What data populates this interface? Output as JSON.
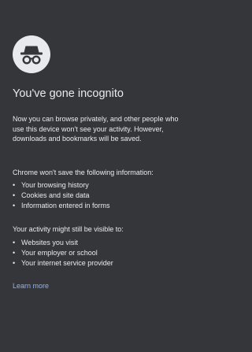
{
  "logo": {
    "icon": "incognito-icon",
    "background_color": "#e8eaed",
    "figure_color": "#35363a"
  },
  "title": "You've gone incognito",
  "intro": "Now you can browse privately, and other people who use this device won't see your activity. However, downloads and bookmarks will be saved.",
  "not_saved": {
    "heading": "Chrome won't save the following information:",
    "items": [
      {
        "bullet": "•",
        "label": "Your browsing history"
      },
      {
        "bullet": "•",
        "label": "Cookies and site data"
      },
      {
        "bullet": "•",
        "label": "Information entered in forms"
      }
    ]
  },
  "visible_to": {
    "heading": "Your activity might still be visible to:",
    "items": [
      {
        "bullet": "•",
        "label": "Websites you visit"
      },
      {
        "bullet": "•",
        "label": "Your employer or school"
      },
      {
        "bullet": "•",
        "label": "Your internet service provider"
      }
    ]
  },
  "learn_more": "Learn more",
  "colors": {
    "background": "#35363a",
    "text": "#e8eaed",
    "link": "#8ab4f8"
  }
}
